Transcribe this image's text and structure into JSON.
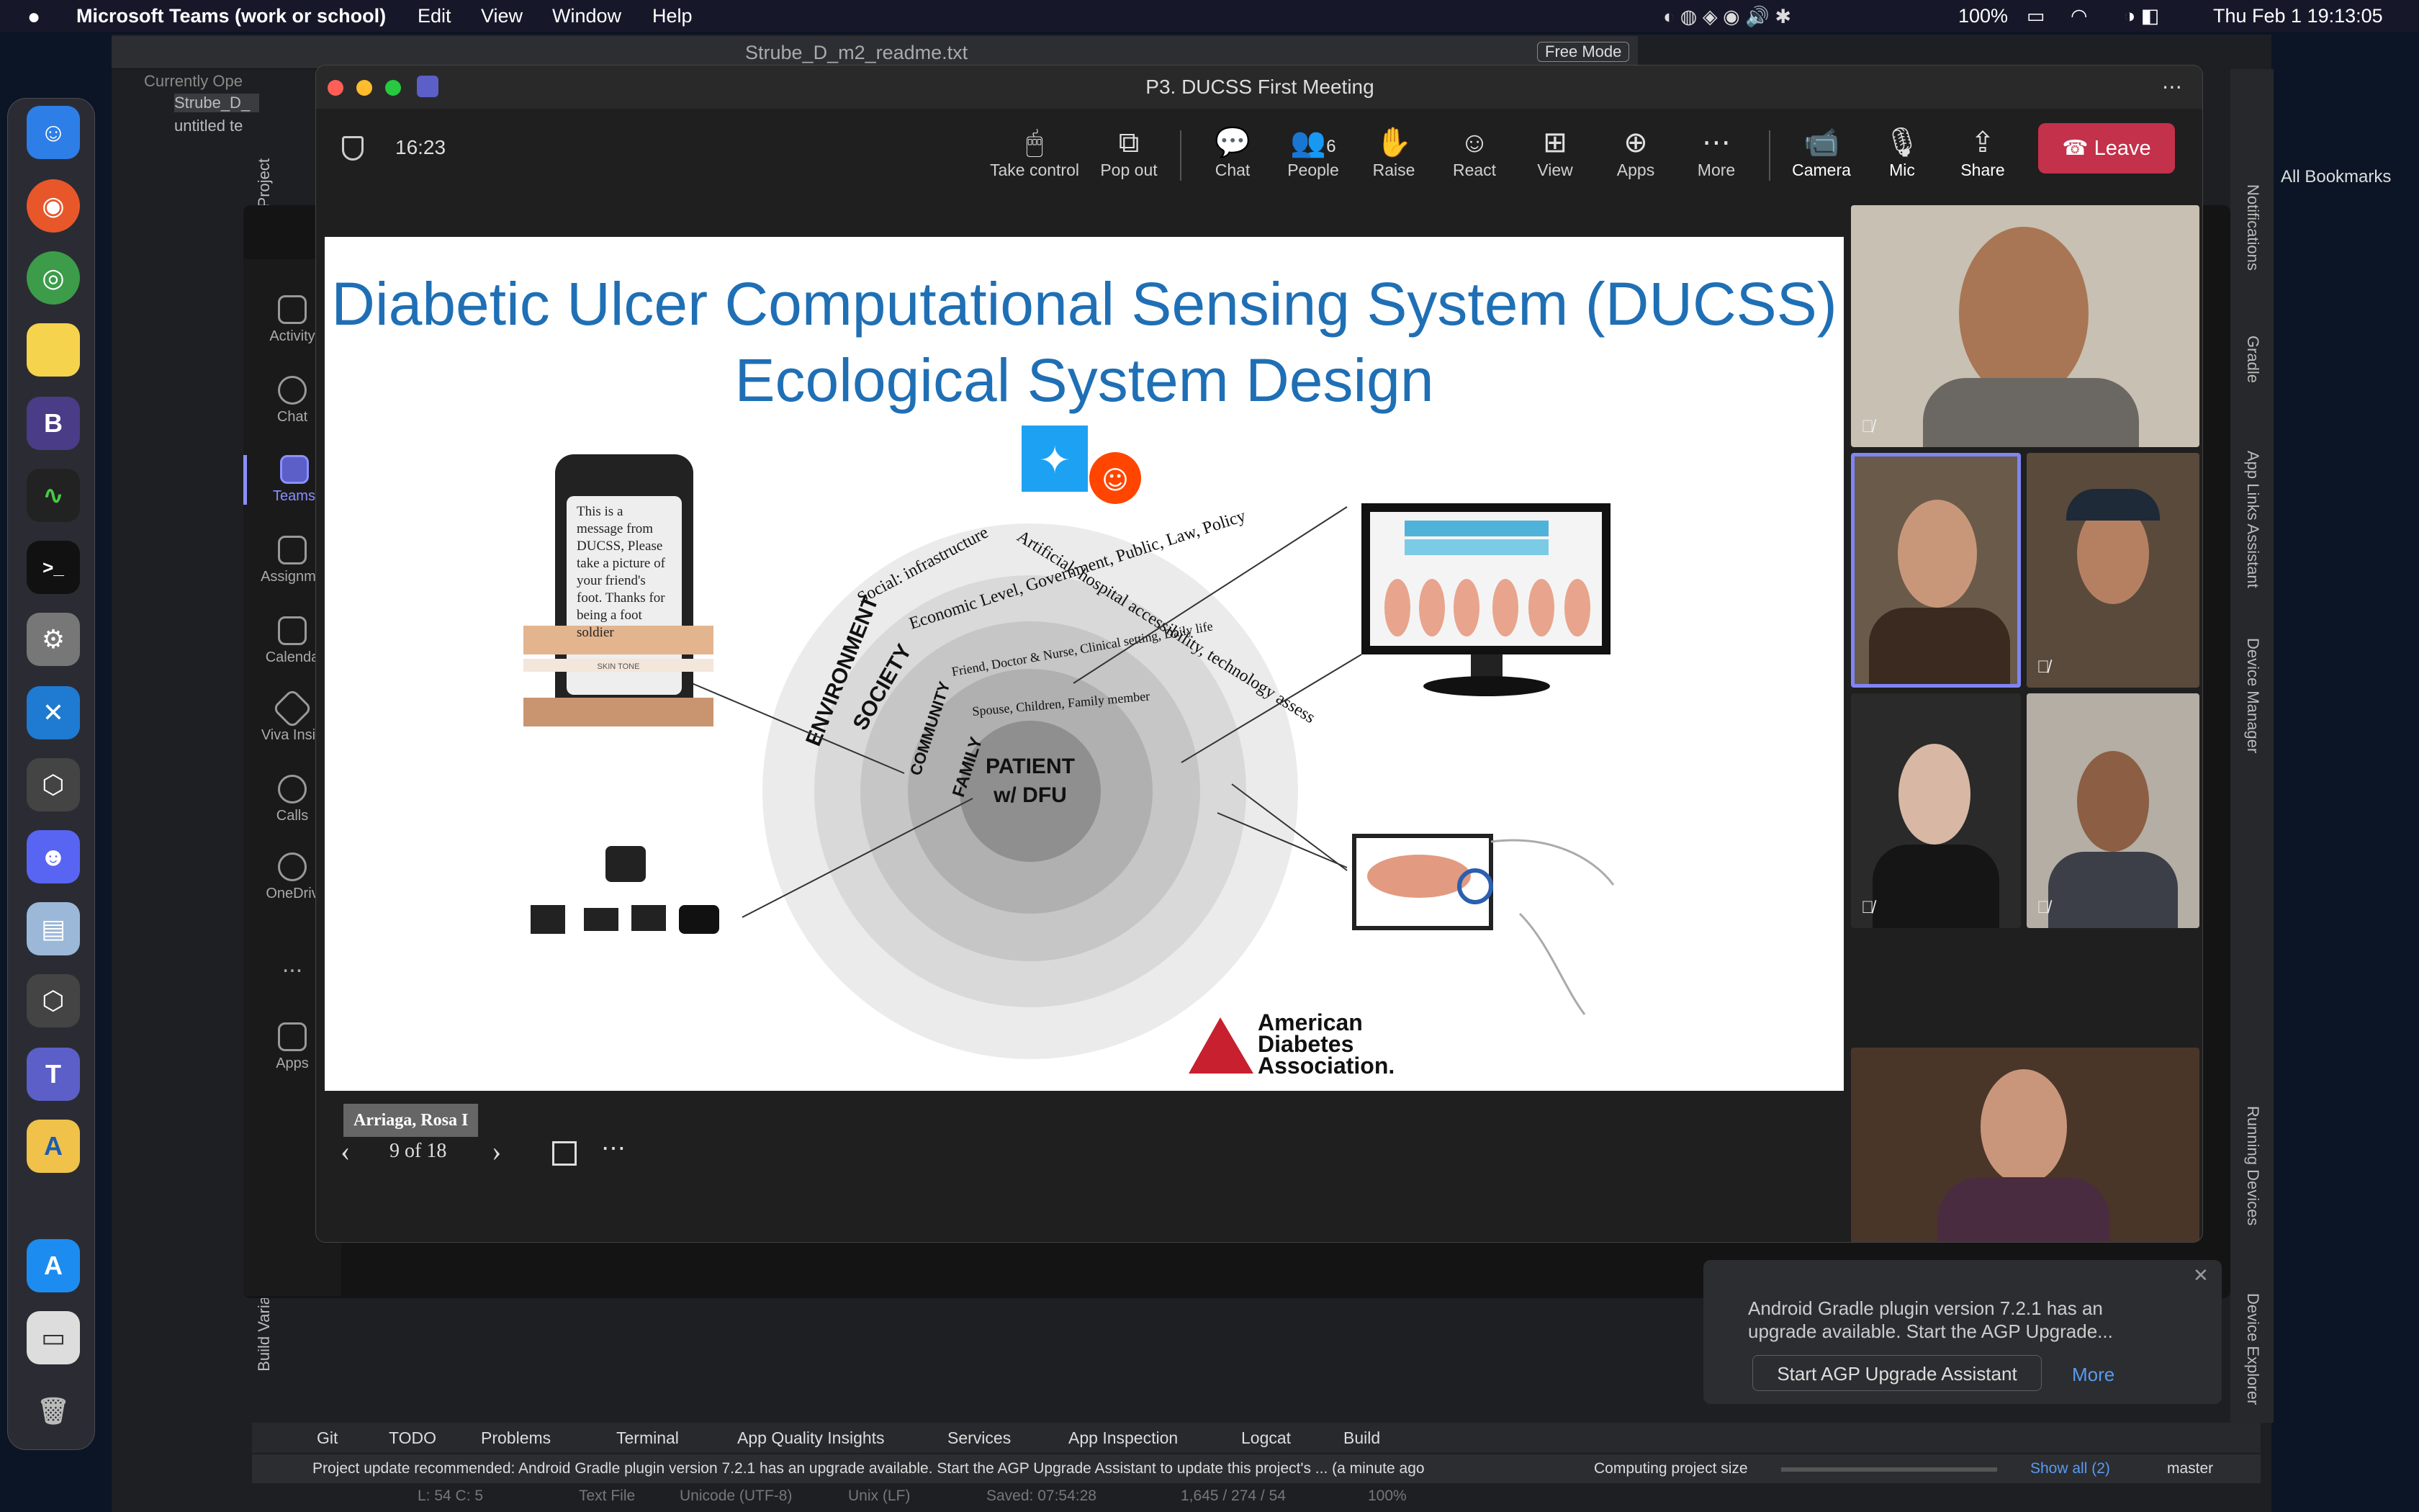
{
  "menubar": {
    "app": "Microsoft Teams (work or school)",
    "items": [
      "Edit",
      "View",
      "Window",
      "Help"
    ],
    "battery": "100%",
    "datetime": "Thu Feb 1  19:13:05"
  },
  "textedit": {
    "title": "Strube_D_m2_readme.txt",
    "mode": "Free Mode",
    "files": [
      "Currently Ope",
      "Strube_D_",
      "untitled te"
    ]
  },
  "teams_rail": [
    {
      "label": "Activity",
      "icon": "bell-icon"
    },
    {
      "label": "Chat",
      "icon": "chat-icon"
    },
    {
      "label": "Teams",
      "icon": "teams-icon"
    },
    {
      "label": "Assignme",
      "icon": "assignment-icon"
    },
    {
      "label": "Calenda",
      "icon": "calendar-icon"
    },
    {
      "label": "Viva Insig",
      "icon": "viva-icon"
    },
    {
      "label": "Calls",
      "icon": "phone-icon"
    },
    {
      "label": "OneDriv",
      "icon": "cloud-icon"
    },
    {
      "label": "...",
      "icon": "more-icon"
    },
    {
      "label": "Apps",
      "icon": "apps-icon"
    }
  ],
  "meeting": {
    "title": "P3. DUCSS First Meeting",
    "timer": "16:23",
    "toolbar": [
      {
        "label": "Take control",
        "glyph": "🖱"
      },
      {
        "label": "Pop out",
        "glyph": "⧉"
      },
      {
        "label": "Chat",
        "glyph": "💬"
      },
      {
        "label": "People",
        "glyph": "👥",
        "badge": "6"
      },
      {
        "label": "Raise",
        "glyph": "✋"
      },
      {
        "label": "React",
        "glyph": "☺"
      },
      {
        "label": "View",
        "glyph": "⊞"
      },
      {
        "label": "Apps",
        "glyph": "⊕"
      },
      {
        "label": "More",
        "glyph": "⋯"
      },
      {
        "label": "Camera",
        "glyph": "📹"
      },
      {
        "label": "Mic",
        "glyph": "🎙"
      },
      {
        "label": "Share",
        "glyph": "⇪"
      }
    ],
    "leave": "Leave"
  },
  "slide": {
    "title_line1": "Diabetic Ulcer Computational Sensing System (DUCSS)",
    "title_line2": "Ecological System Design",
    "presenter": "Arriaga, Rosa I",
    "page": "9 of 18",
    "phone_text": "This is a message from DUCSS, Please take a picture of your friend's foot. Thanks for being a foot soldier",
    "rings": [
      "ENVIRONMENT",
      "SOCIETY",
      "COMMUNITY",
      "FAMILY"
    ],
    "ring_details": [
      "Social: infrastructure",
      "Artificial: hospital accessibility, technology assess",
      "Economic Level, Government, Public, Law, Policy",
      "Friend, Doctor & Nurse, Clinical setting, Daily life",
      "Spouse, Children, Family member"
    ],
    "center": [
      "PATIENT",
      "w/ DFU"
    ],
    "skin_tone": "SKIN TONE",
    "ada": [
      "American",
      "Diabetes",
      "Association."
    ]
  },
  "ide": {
    "notification": [
      "Android Gradle plugin version 7.2.1 has an",
      "upgrade available. Start the AGP Upgrade..."
    ],
    "agp_button": "Start AGP Upgrade Assistant",
    "more": "More",
    "bottom_tools": [
      "Git",
      "TODO",
      "Problems",
      "Terminal",
      "App Quality Insights",
      "Services",
      "App Inspection",
      "Logcat",
      "Build"
    ],
    "status": "Project update recommended: Android Gradle plugin version 7.2.1 has an upgrade available.  Start the AGP Upgrade Assistant to update this project's ... (a minute ago",
    "computing": "Computing project size",
    "show_all": "Show all (2)",
    "branch": "master",
    "side_tabs": [
      "Notifications",
      "Gradle",
      "App Links Assistant",
      "Device Manager",
      "Running Devices",
      "Device Explorer"
    ],
    "left_tabs": [
      "Project",
      "Build Varia"
    ],
    "bookmarks": "All Bookmarks",
    "statusline": [
      "L: 54 C: 5",
      "Text File",
      "Unicode (UTF-8)",
      "Unix (LF)",
      "Saved: 07:54:28",
      "1,645 / 274 / 54",
      "100%"
    ]
  }
}
